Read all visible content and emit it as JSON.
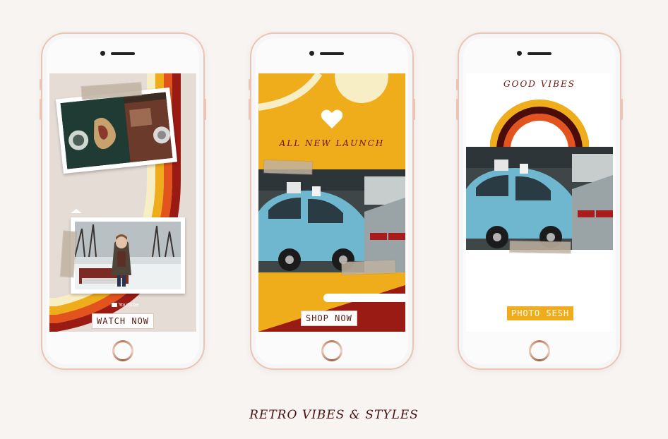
{
  "screens": [
    {
      "button_label": "WATCH NOW",
      "badge": "YouTube"
    },
    {
      "headline": "ALL NEW LAUNCH",
      "button_label": "SHOP NOW"
    },
    {
      "headline": "GOOD VIBES",
      "button_label": "PHOTO SESH"
    }
  ],
  "caption": "RETRO VIBES & STYLES",
  "colors": {
    "mustard": "#efad1b",
    "maroon": "#9a1b14",
    "orange": "#e2531d",
    "cream": "#f8eec5",
    "dark": "#4b0c0c"
  },
  "icons": {
    "heart": "heart-icon"
  }
}
